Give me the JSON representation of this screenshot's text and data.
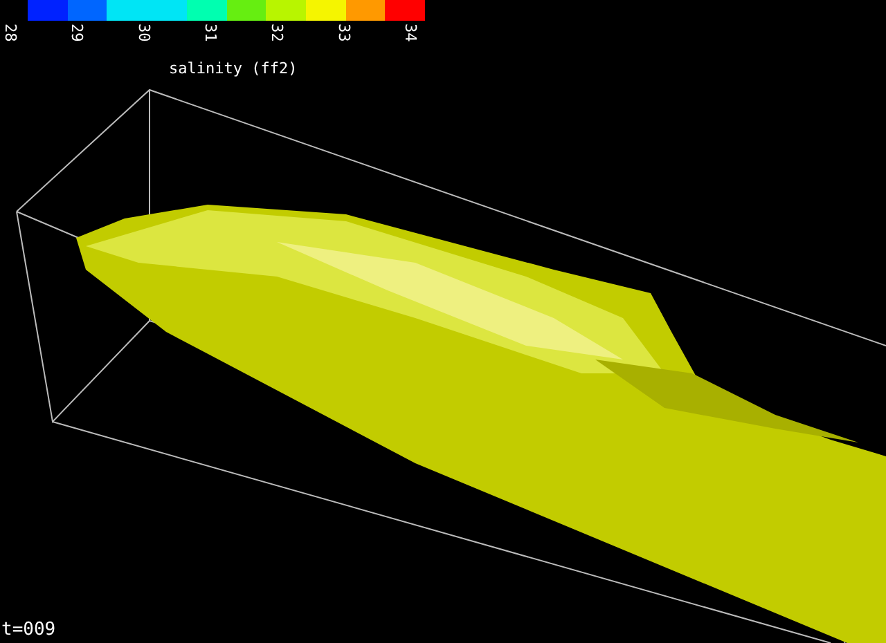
{
  "colorbar": {
    "title": "salinity (ff2)",
    "segments": [
      {
        "color": "#0022ff"
      },
      {
        "color": "#0066ff"
      },
      {
        "color": "#00e5f5"
      },
      {
        "color": "#00e5f5"
      },
      {
        "color": "#00ffb0"
      },
      {
        "color": "#66ee11"
      },
      {
        "color": "#b8f500"
      },
      {
        "color": "#f5f500"
      },
      {
        "color": "#ff9900"
      },
      {
        "color": "#ff0000"
      }
    ],
    "ticks": [
      "28",
      "29",
      "30",
      "31",
      "32",
      "33",
      "34"
    ]
  },
  "time_label": "t=009"
}
